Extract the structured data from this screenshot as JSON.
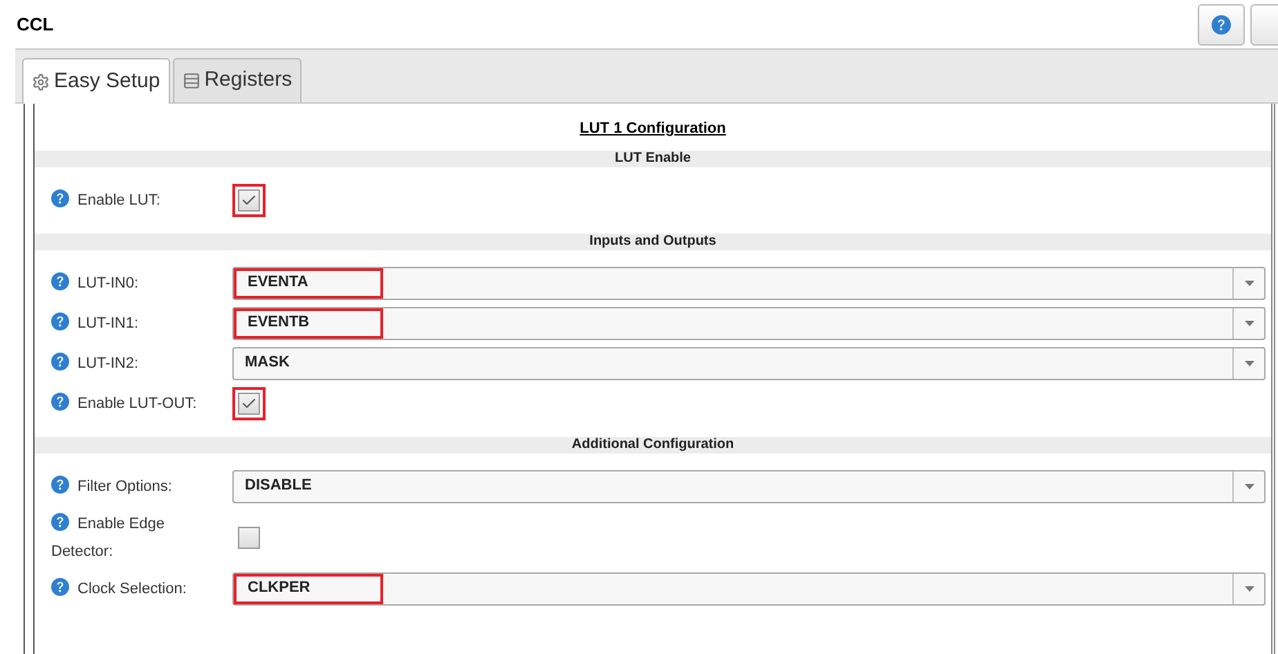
{
  "window": {
    "title": "CCL"
  },
  "tabs": [
    {
      "label": "Easy Setup",
      "kind": "gear",
      "selected": true
    },
    {
      "label": "Registers",
      "kind": "list",
      "selected": false
    }
  ],
  "panel_title": "LUT 1 Configuration",
  "sections": [
    {
      "title": "LUT Enable",
      "rows": [
        {
          "kind": "checkbox",
          "label": "Enable LUT:",
          "checked": true,
          "highlighted": true
        }
      ]
    },
    {
      "title": "Inputs and Outputs",
      "rows": [
        {
          "kind": "dropdown",
          "label": "LUT-IN0:",
          "value": "EVENTA",
          "highlighted": true
        },
        {
          "kind": "dropdown",
          "label": "LUT-IN1:",
          "value": "EVENTB",
          "highlighted": true
        },
        {
          "kind": "dropdown",
          "label": "LUT-IN2:",
          "value": "MASK",
          "highlighted": false
        },
        {
          "kind": "checkbox",
          "label": "Enable LUT-OUT:",
          "checked": true,
          "highlighted": true
        }
      ]
    },
    {
      "title": "Additional Configuration",
      "rows": [
        {
          "kind": "dropdown",
          "label": "Filter Options:",
          "value": "DISABLE",
          "highlighted": false
        },
        {
          "kind": "checkbox",
          "label": "Enable Edge Detector:",
          "checked": false,
          "highlighted": false
        },
        {
          "kind": "dropdown",
          "label": "Clock Selection:",
          "value": "CLKPER",
          "highlighted": true
        }
      ]
    }
  ]
}
